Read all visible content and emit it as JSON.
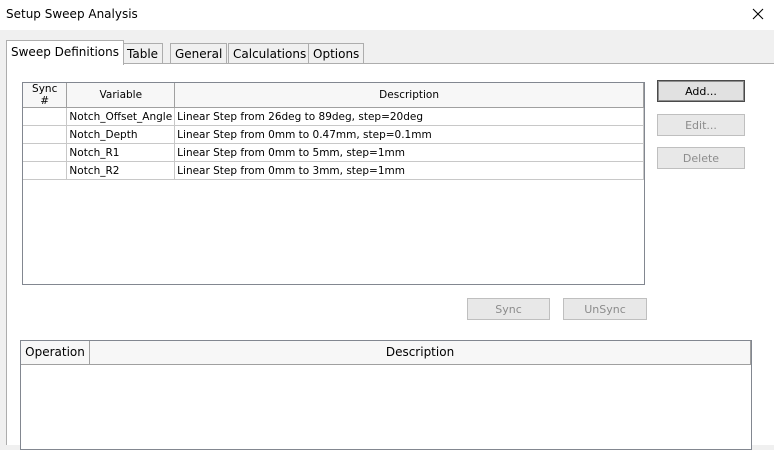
{
  "window": {
    "title": "Setup Sweep Analysis"
  },
  "tabs": [
    {
      "label": "Sweep Definitions",
      "active": true
    },
    {
      "label": "Table",
      "active": false
    },
    {
      "label": "General",
      "active": false
    },
    {
      "label": "Calculations",
      "active": false
    },
    {
      "label": "Options",
      "active": false
    }
  ],
  "sweep_table": {
    "columns": [
      "Sync #",
      "Variable",
      "Description"
    ],
    "rows": [
      {
        "sync": "",
        "variable": "Notch_Offset_Angle",
        "description": "Linear Step from 26deg to 89deg, step=20deg"
      },
      {
        "sync": "",
        "variable": "Notch_Depth",
        "description": "Linear Step from 0mm to 0.47mm, step=0.1mm"
      },
      {
        "sync": "",
        "variable": "Notch_R1",
        "description": "Linear Step from 0mm to 5mm, step=1mm"
      },
      {
        "sync": "",
        "variable": "Notch_R2",
        "description": "Linear Step from 0mm to 3mm, step=1mm"
      }
    ]
  },
  "buttons": {
    "add": "Add...",
    "edit": "Edit...",
    "delete": "Delete",
    "sync": "Sync",
    "unsync": "UnSync"
  },
  "operations_table": {
    "columns": [
      "Operation",
      "Description"
    ]
  }
}
